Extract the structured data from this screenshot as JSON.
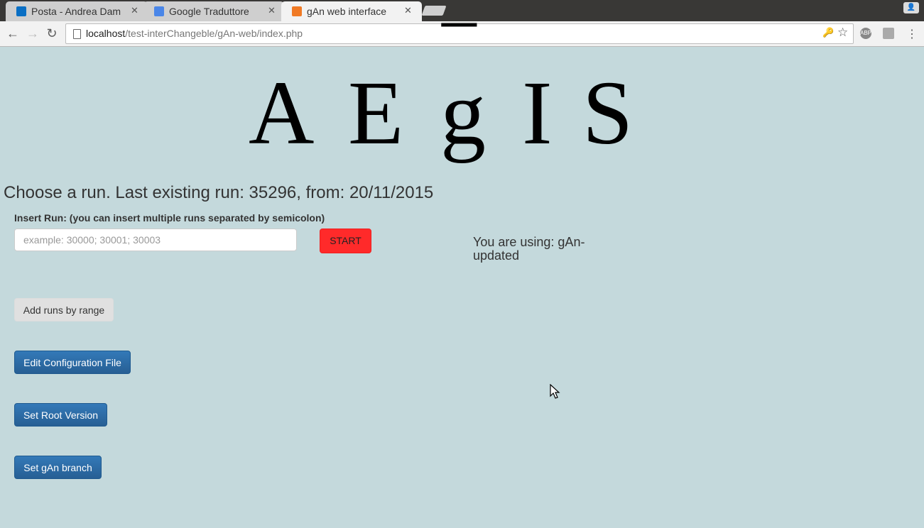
{
  "browser": {
    "tabs": [
      {
        "title": "Posta - Andrea Dam",
        "icon": "outlook-icon",
        "icon_color": "#0a6fc4"
      },
      {
        "title": "Google Traduttore",
        "icon": "google-translate-icon",
        "icon_color": "#4a86e8"
      },
      {
        "title": "gAn web interface",
        "icon": "xampp-icon",
        "icon_color": "#f07a25"
      }
    ],
    "url_host": "localhost",
    "url_path": "/test-interChangeble/gAn-web/index.php"
  },
  "page": {
    "logo": {
      "letters": [
        "A",
        "E",
        "g",
        "I",
        "S"
      ],
      "overbar": "‾"
    },
    "heading": "Choose a run. Last existing run: 35296, from: 20/11/2015",
    "insert_run_label": "Insert Run: (you can insert multiple runs separated by semicolon)",
    "run_input_placeholder": "example: 30000; 30001; 30003",
    "run_input_value": "",
    "start_label": "START",
    "using_text": "You are using: gAn-updated",
    "buttons": {
      "add_range": "Add runs by range",
      "edit_config": "Edit Configuration File",
      "set_root": "Set Root Version",
      "set_gan": "Set gAn branch"
    }
  },
  "colors": {
    "page_bg": "#c4d9dc",
    "start_button": "#ff2a2a",
    "primary_button": "#3379b8"
  }
}
